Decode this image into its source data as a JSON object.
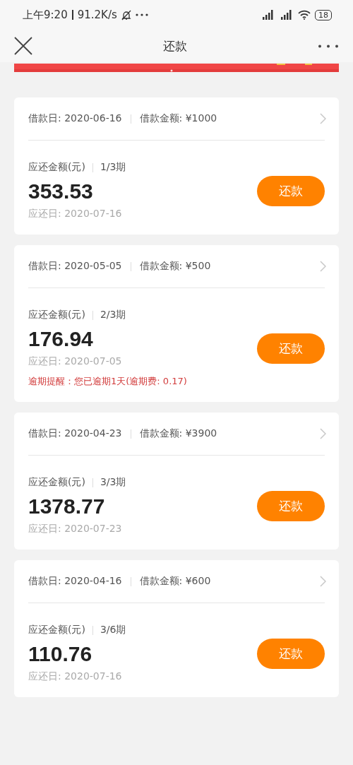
{
  "status_bar": {
    "time": "上午9:20",
    "speed": "91.2K/s",
    "battery": "18"
  },
  "header": {
    "title": "还款"
  },
  "loans": [
    {
      "loan_date": "借款日: 2020-06-16",
      "loan_amount": "借款金额: ¥1000",
      "due_label": "应还金额(元)",
      "period": "1/3期",
      "amount": "353.53",
      "due_date": "应还日: 2020-07-16",
      "button": "还款"
    },
    {
      "loan_date": "借款日: 2020-05-05",
      "loan_amount": "借款金额: ¥500",
      "due_label": "应还金额(元)",
      "period": "2/3期",
      "amount": "176.94",
      "due_date": "应还日: 2020-07-05",
      "overdue": "逾期提醒：您已逾期1天(逾期费: 0.17)",
      "button": "还款"
    },
    {
      "loan_date": "借款日: 2020-04-23",
      "loan_amount": "借款金额: ¥3900",
      "due_label": "应还金额(元)",
      "period": "3/3期",
      "amount": "1378.77",
      "due_date": "应还日: 2020-07-23",
      "button": "还款"
    },
    {
      "loan_date": "借款日: 2020-04-16",
      "loan_amount": "借款金额: ¥600",
      "due_label": "应还金额(元)",
      "period": "3/6期",
      "amount": "110.76",
      "due_date": "应还日: 2020-07-16",
      "button": "还款"
    }
  ]
}
